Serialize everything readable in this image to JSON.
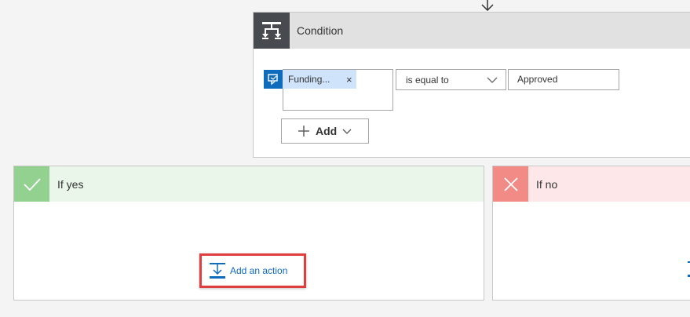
{
  "condition": {
    "title": "Condition",
    "icon": "condition-icon",
    "left_operand": {
      "label": "Funding...",
      "remove": "×",
      "icon": "sharepoint-icon"
    },
    "operator": {
      "selected": "is equal to"
    },
    "value": "Approved",
    "add_label": "Add"
  },
  "branches": {
    "yes": {
      "title": "If yes",
      "icon": "check-icon",
      "add_action_label": "Add an action"
    },
    "no": {
      "title": "If no",
      "icon": "x-icon"
    }
  },
  "colors": {
    "condition_icon_bg": "#474a4f",
    "yes_header": "#ebf6eb",
    "yes_icon_bg": "#92d190",
    "no_header": "#fde7e9",
    "no_icon_bg": "#f28b85",
    "link": "#0f6cbd",
    "highlight": "#e03e3e"
  }
}
